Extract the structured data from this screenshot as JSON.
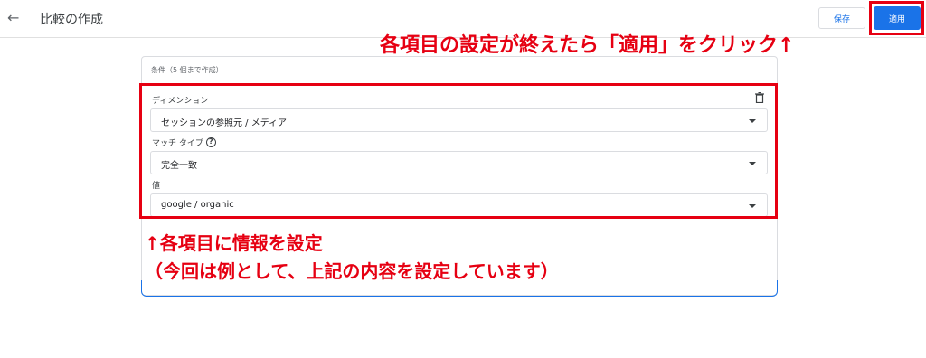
{
  "header": {
    "back_icon": "←",
    "title": "比較の作成",
    "save_label": "保存",
    "apply_label": "適用"
  },
  "annotations": {
    "apply_note": "各項目の設定が終えたら「適用」をクリック↑",
    "fields_note": "↑各項目に情報を設定",
    "example_note": "（今回は例として、上記の内容を設定しています）"
  },
  "condition": {
    "title": "条件（5 個まで作成）",
    "delete_icon": "trash-icon",
    "dimension": {
      "label": "ディメンション",
      "value": "セッションの参照元 / メディア"
    },
    "match_type": {
      "label": "マッチ タイプ",
      "help_icon": "?",
      "value": "完全一致"
    },
    "value_field": {
      "label": "値",
      "value": "google / organic"
    }
  },
  "colors": {
    "accent": "#1a73e8",
    "annotation_red": "#e60012"
  }
}
